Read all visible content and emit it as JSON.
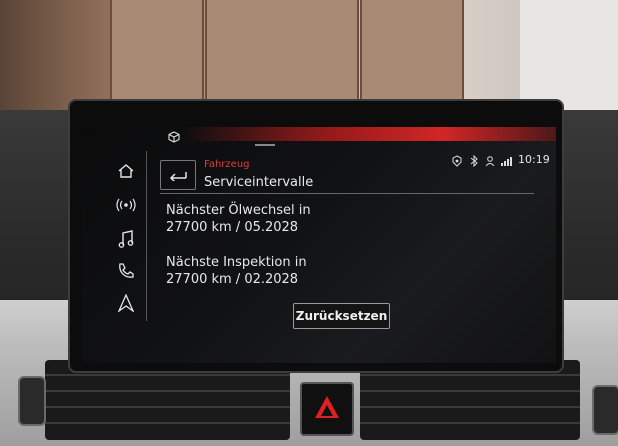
{
  "status_bar": {
    "time": "10:19",
    "icons": [
      "car-connect-icon",
      "bluetooth-icon",
      "user-icon",
      "signal-icon"
    ]
  },
  "sidebar": {
    "items": [
      {
        "icon": "home-icon"
      },
      {
        "icon": "radio-icon"
      },
      {
        "icon": "music-icon"
      },
      {
        "icon": "phone-icon"
      },
      {
        "icon": "navigation-icon"
      }
    ]
  },
  "header": {
    "breadcrumb": "Fahrzeug",
    "title": "Serviceintervalle"
  },
  "service": {
    "oil_label": "Nächster Ölwechsel in",
    "oil_value": "27700 km / 05.2028",
    "inspection_label": "Nächste Inspektion in",
    "inspection_value": "27700 km / 02.2028"
  },
  "actions": {
    "reset_label": "Zurücksetzen"
  },
  "colors": {
    "accent": "#e23b3b",
    "text": "#e8e8e8",
    "screen_bg": "#111214"
  }
}
